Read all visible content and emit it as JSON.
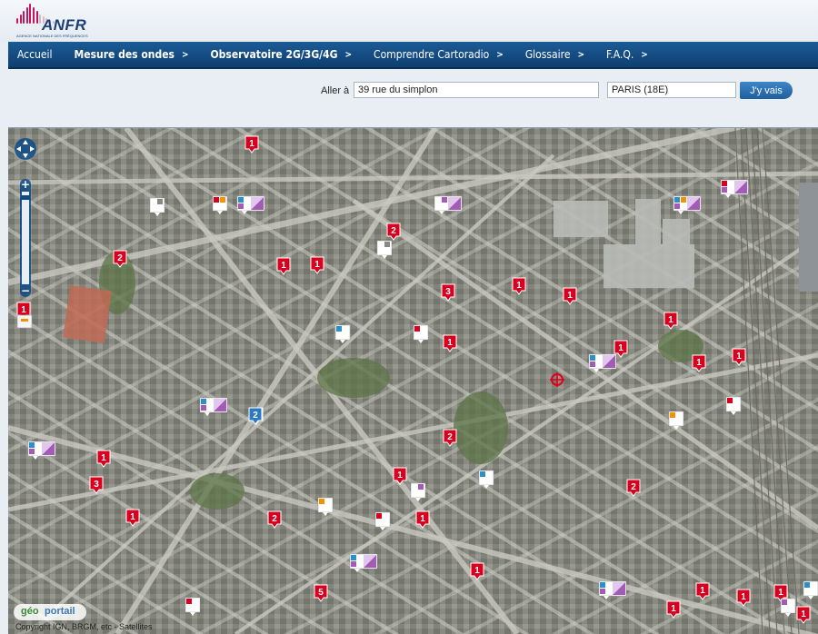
{
  "header": {
    "logo_name": "ANFR",
    "logo_tagline": "AGENCE NATIONALE DES FRÉQUENCES",
    "brand_color": "#1b3f7a",
    "accent_color": "#c2185b"
  },
  "nav": {
    "items": [
      {
        "label": "Accueil",
        "bold": false,
        "has_arrow": false
      },
      {
        "label": "Mesure des ondes",
        "bold": true,
        "has_arrow": true
      },
      {
        "label": "Observatoire 2G/3G/4G",
        "bold": true,
        "has_arrow": true
      },
      {
        "label": "Comprendre Cartoradio",
        "bold": false,
        "has_arrow": true
      },
      {
        "label": "Glossaire",
        "bold": false,
        "has_arrow": true
      },
      {
        "label": "F.A.Q.",
        "bold": false,
        "has_arrow": true
      }
    ],
    "arrow_glyph": ">"
  },
  "search": {
    "label": "Aller à",
    "address_value": "39 rue du simplon",
    "city_value": "PARIS (18E)",
    "go_label": "J'y vais"
  },
  "map": {
    "attribution_logo_a": "géo",
    "attribution_logo_b": "portail",
    "copyright": "Copyright IGN, BRGM, etc - Satellites",
    "markers_count_style": {
      "fill": "#d8001e",
      "stroke": "#ffffff"
    },
    "count_markers": [
      "1",
      "2",
      "2",
      "1",
      "1",
      "3",
      "1",
      "1",
      "1",
      "1",
      "1",
      "1",
      "1",
      "2",
      "2",
      "1",
      "2",
      "3",
      "1",
      "1",
      "2",
      "1",
      "2",
      "1",
      "5",
      "1",
      "1",
      "1",
      "1",
      "1",
      "1",
      "1"
    ],
    "blue_marker": "2",
    "icons": {
      "pan": "pan-arrows-icon",
      "zoom_in": "plus-icon",
      "zoom_out": "minus-icon",
      "target": "target-crosshair-icon"
    }
  }
}
